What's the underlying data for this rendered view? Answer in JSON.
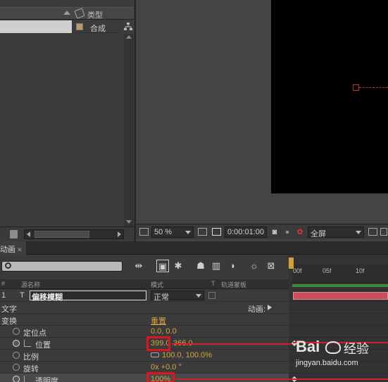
{
  "project": {
    "type_header": "类型",
    "item_type": "合成"
  },
  "viewer": {
    "zoom": "50 %",
    "timecode": "0:00:01:00",
    "resolution": "全屏"
  },
  "timeline": {
    "tab_label": "动画",
    "ruler_ticks": [
      "00f",
      "05f",
      "10f"
    ],
    "columns": {
      "num": "#",
      "layer_name": "源名称",
      "mode": "模式",
      "t": "T",
      "trkmat": "轨道蒙板"
    },
    "layer": {
      "index": "1",
      "type_icon": "T",
      "name": "偏移模糊",
      "mode": "正常"
    },
    "text_group": "文字",
    "animate_label": "动画:",
    "transform_group": "变换",
    "reset_label": "重置",
    "props": [
      {
        "label": "定位点",
        "value": "0.0, 0.0"
      },
      {
        "label": "位置",
        "value_a": "399.0",
        "value_b": "366.0"
      },
      {
        "label": "比例",
        "value": "100.0, 100.0%"
      },
      {
        "label": "旋转",
        "value": "0x +0.0 °"
      },
      {
        "label": "透明度",
        "value": "100%"
      }
    ]
  },
  "watermark": {
    "brand": "Bai",
    "brand2": "经验",
    "url": "jingyan.baidu.com"
  },
  "colors": {
    "highlight_red": "#e0141c",
    "value_orange": "#d4a63c",
    "layer_bar": "#c9505a",
    "work_area_green": "#3a8a3a"
  }
}
